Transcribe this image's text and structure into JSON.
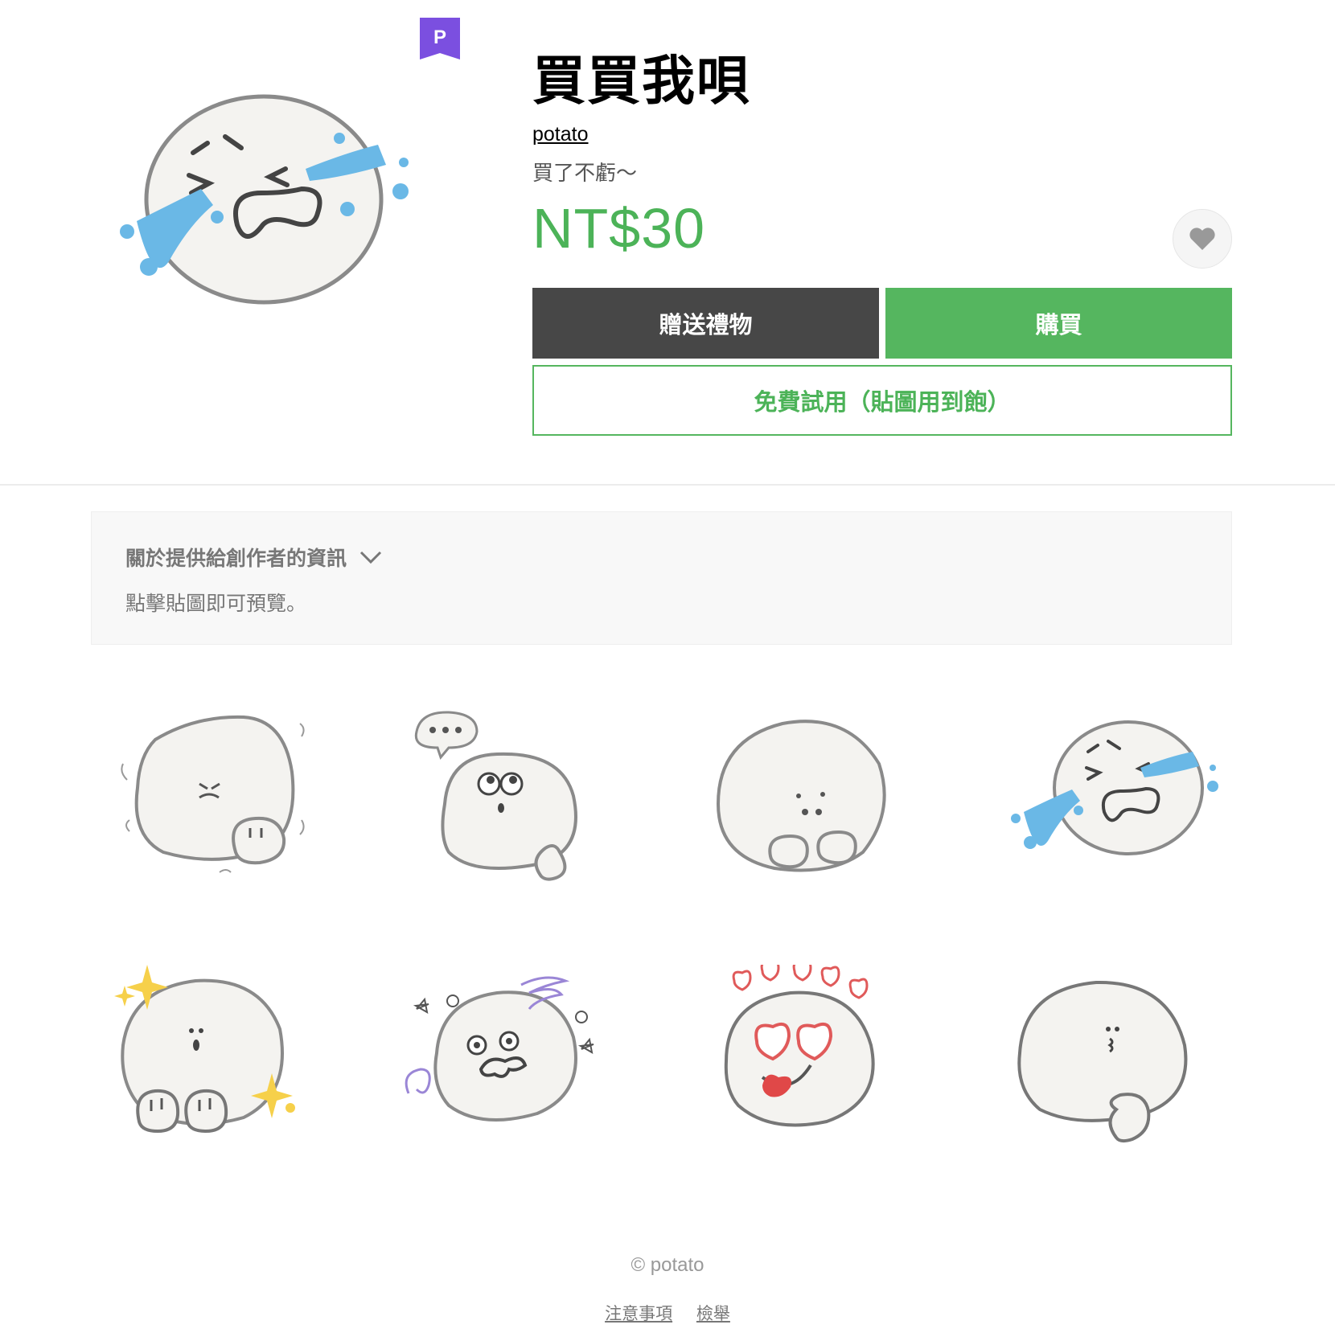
{
  "product": {
    "title": "買買我唄",
    "author": "potato",
    "description": "買了不虧～",
    "price": "NT$30",
    "premium_badge": "P"
  },
  "buttons": {
    "gift": "贈送禮物",
    "buy": "購買",
    "trial": "免費試用（貼圖用到飽）"
  },
  "creator_info": {
    "heading": "關於提供給創作者的資訊",
    "hint": "點擊貼圖即可預覽。"
  },
  "stickers": [
    {
      "name": "angry-shaking"
    },
    {
      "name": "thinking-speech"
    },
    {
      "name": "shy-hiding"
    },
    {
      "name": "crying"
    },
    {
      "name": "sparkle-surprised"
    },
    {
      "name": "dizzy-confused"
    },
    {
      "name": "love-hearts"
    },
    {
      "name": "pondering"
    }
  ],
  "footer": {
    "copyright": "© potato",
    "notice_link": "注意事項",
    "report_link": "檢舉"
  },
  "colors": {
    "accent_green": "#4cb358",
    "gift_button": "#474747",
    "premium_purple": "#7b4fe0",
    "tear_blue": "#6ab8e6"
  }
}
